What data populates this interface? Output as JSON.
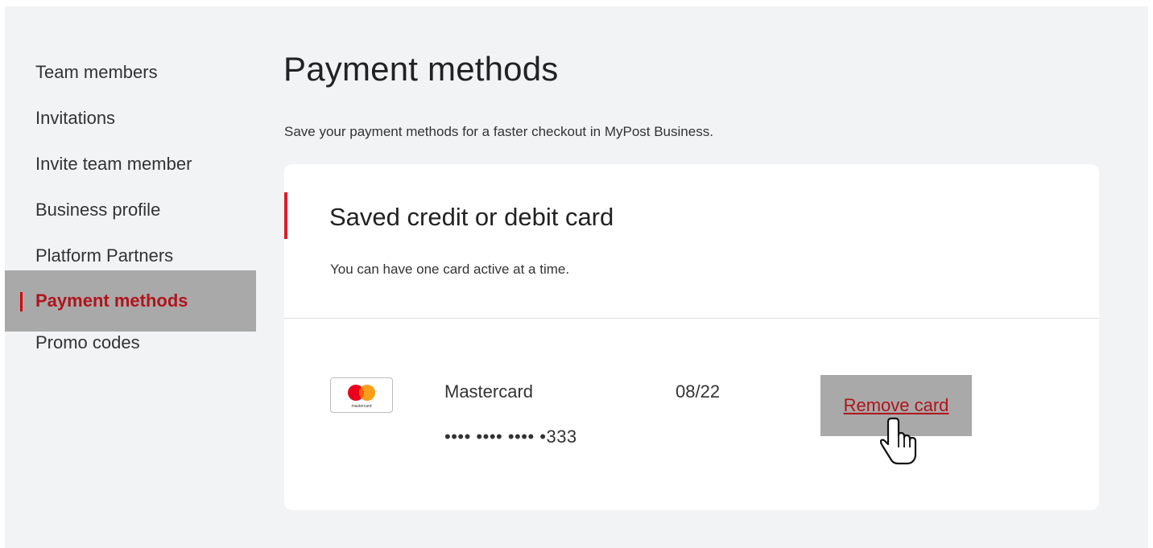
{
  "sidebar": {
    "items": [
      {
        "label": "Team members"
      },
      {
        "label": "Invitations"
      },
      {
        "label": "Invite team member"
      },
      {
        "label": "Business profile"
      },
      {
        "label": "Platform Partners"
      },
      {
        "label": "Payment methods",
        "active": true
      },
      {
        "label": "Promo codes"
      }
    ]
  },
  "main": {
    "title": "Payment methods",
    "subtitle": "Save your payment methods for a faster checkout in MyPost Business."
  },
  "card_section": {
    "title": "Saved credit or debit card",
    "subtitle": "You can have one card active at a time.",
    "saved_card": {
      "logo_icon": "mastercard-logo-icon",
      "logo_text": "mastercard",
      "brand": "Mastercard",
      "number": "•••• •••• •••• •333",
      "expiry": "08/22",
      "remove_label": "Remove card"
    }
  },
  "colors": {
    "accent": "#d8202a",
    "active_text": "#b0141c",
    "highlight": "#a9a9a9",
    "background": "#f2f3f5"
  },
  "cursor_icon": "hand-pointer-icon"
}
